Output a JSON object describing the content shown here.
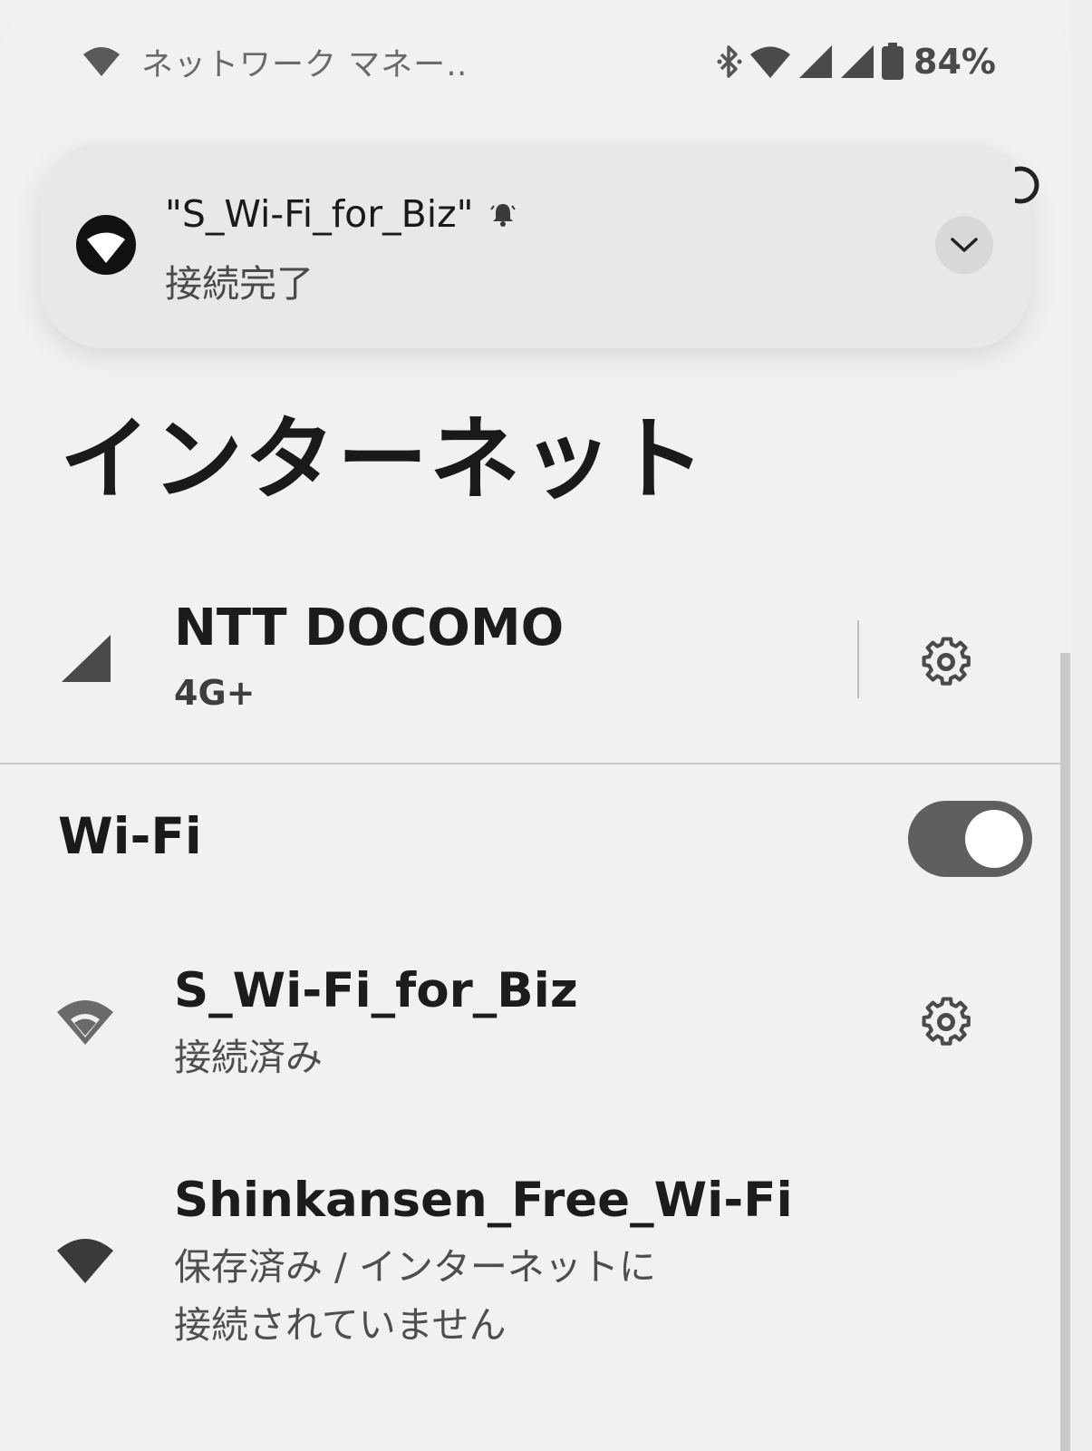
{
  "status_bar": {
    "notification_title": "ネットワーク マネー‥",
    "battery_percent": "84%",
    "icons": [
      "wifi-icon",
      "bluetooth-icon",
      "wifi-icon",
      "signal-icon",
      "signal-icon",
      "battery-icon"
    ]
  },
  "notification": {
    "title": "\"S_Wi-Fi_for_Biz\"",
    "status": "接続完了",
    "icons": [
      "wifi-icon",
      "bell-icon",
      "chevron-down-icon"
    ]
  },
  "page": {
    "title": "インターネット"
  },
  "carrier": {
    "name": "NTT DOCOMO",
    "network_type": "4G+"
  },
  "wifi": {
    "label": "Wi-Fi",
    "enabled": true
  },
  "networks": [
    {
      "name": "S_Wi-Fi_for_Biz",
      "status": "接続済み"
    },
    {
      "name": "Shinkansen_Free_Wi-Fi",
      "status_line1": "保存済み / インターネットに",
      "status_line2": "接続されていません"
    }
  ],
  "colors": {
    "background": "#f1f1f1",
    "toggle_track": "#5f5f5f",
    "icon": "#505050"
  }
}
